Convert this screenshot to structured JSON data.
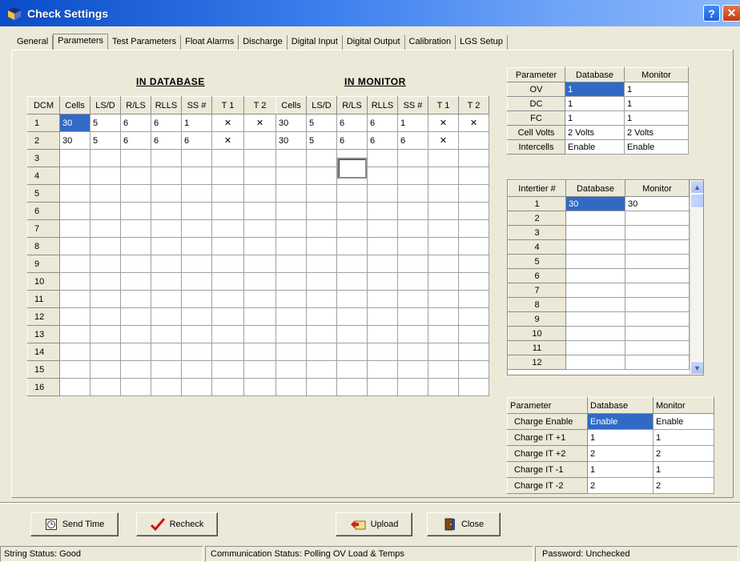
{
  "window": {
    "title": "Check Settings",
    "help_label": "?",
    "close_label": "✕"
  },
  "tabs": [
    "General",
    "Parameters",
    "Test Parameters",
    "Float Alarms",
    "Discharge",
    "Digital Input",
    "Digital Output",
    "Calibration",
    "LGS Setup"
  ],
  "active_tab": 1,
  "in_database": {
    "title": "IN DATABASE",
    "columns": [
      "DCM",
      "Cells",
      "LS/D",
      "R/LS",
      "RLLS",
      "SS #",
      "T 1",
      "T 2"
    ],
    "rows": [
      [
        "1",
        "30",
        "5",
        "6",
        "6",
        "1",
        "✕",
        "✕"
      ],
      [
        "2",
        "30",
        "5",
        "6",
        "6",
        "6",
        "✕",
        ""
      ],
      [
        "3",
        "",
        "",
        "",
        "",
        "",
        "",
        ""
      ],
      [
        "4",
        "",
        "",
        "",
        "",
        "",
        "",
        ""
      ],
      [
        "5",
        "",
        "",
        "",
        "",
        "",
        "",
        ""
      ],
      [
        "6",
        "",
        "",
        "",
        "",
        "",
        "",
        ""
      ],
      [
        "7",
        "",
        "",
        "",
        "",
        "",
        "",
        ""
      ],
      [
        "8",
        "",
        "",
        "",
        "",
        "",
        "",
        ""
      ],
      [
        "9",
        "",
        "",
        "",
        "",
        "",
        "",
        ""
      ],
      [
        "10",
        "",
        "",
        "",
        "",
        "",
        "",
        ""
      ],
      [
        "11",
        "",
        "",
        "",
        "",
        "",
        "",
        ""
      ],
      [
        "12",
        "",
        "",
        "",
        "",
        "",
        "",
        ""
      ],
      [
        "13",
        "",
        "",
        "",
        "",
        "",
        "",
        ""
      ],
      [
        "14",
        "",
        "",
        "",
        "",
        "",
        "",
        ""
      ],
      [
        "15",
        "",
        "",
        "",
        "",
        "",
        "",
        ""
      ],
      [
        "16",
        "",
        "",
        "",
        "",
        "",
        "",
        ""
      ]
    ]
  },
  "in_monitor": {
    "title": "IN MONITOR",
    "columns": [
      "Cells",
      "LS/D",
      "R/LS",
      "RLLS",
      "SS #",
      "T 1",
      "T 2"
    ],
    "rows": [
      [
        "30",
        "5",
        "6",
        "6",
        "1",
        "✕",
        "✕"
      ],
      [
        "30",
        "5",
        "6",
        "6",
        "6",
        "✕",
        ""
      ],
      [
        "",
        "",
        "",
        "",
        "",
        "",
        ""
      ],
      [
        "",
        "",
        "",
        "",
        "",
        "",
        ""
      ],
      [
        "",
        "",
        "",
        "",
        "",
        "",
        ""
      ],
      [
        "",
        "",
        "",
        "",
        "",
        "",
        ""
      ],
      [
        "",
        "",
        "",
        "",
        "",
        "",
        ""
      ],
      [
        "",
        "",
        "",
        "",
        "",
        "",
        ""
      ],
      [
        "",
        "",
        "",
        "",
        "",
        "",
        ""
      ],
      [
        "",
        "",
        "",
        "",
        "",
        "",
        ""
      ],
      [
        "",
        "",
        "",
        "",
        "",
        "",
        ""
      ],
      [
        "",
        "",
        "",
        "",
        "",
        "",
        ""
      ],
      [
        "",
        "",
        "",
        "",
        "",
        "",
        ""
      ],
      [
        "",
        "",
        "",
        "",
        "",
        "",
        ""
      ],
      [
        "",
        "",
        "",
        "",
        "",
        "",
        ""
      ],
      [
        "",
        "",
        "",
        "",
        "",
        "",
        ""
      ]
    ]
  },
  "param_table": {
    "columns": [
      "Parameter",
      "Database",
      "Monitor"
    ],
    "rows": [
      [
        "OV",
        "1",
        "1"
      ],
      [
        "DC",
        "1",
        "1"
      ],
      [
        "FC",
        "1",
        "1"
      ],
      [
        "Cell Volts",
        "2 Volts",
        "2 Volts"
      ],
      [
        "Intercells",
        "Enable",
        "Enable"
      ]
    ]
  },
  "intertier_table": {
    "columns": [
      "Intertier #",
      "Database",
      "Monitor"
    ],
    "rows": [
      [
        "1",
        "30",
        "30"
      ],
      [
        "2",
        "",
        ""
      ],
      [
        "3",
        "",
        ""
      ],
      [
        "4",
        "",
        ""
      ],
      [
        "5",
        "",
        ""
      ],
      [
        "6",
        "",
        ""
      ],
      [
        "7",
        "",
        ""
      ],
      [
        "8",
        "",
        ""
      ],
      [
        "9",
        "",
        ""
      ],
      [
        "10",
        "",
        ""
      ],
      [
        "11",
        "",
        ""
      ],
      [
        "12",
        "",
        ""
      ]
    ]
  },
  "charge_table": {
    "columns": [
      "Parameter",
      "Database",
      "Monitor"
    ],
    "rows": [
      [
        "Charge Enable",
        "Enable",
        "Enable"
      ],
      [
        "Charge IT +1",
        "1",
        "1"
      ],
      [
        "Charge IT +2",
        "2",
        "2"
      ],
      [
        "Charge IT -1",
        "1",
        "1"
      ],
      [
        "Charge IT -2",
        "2",
        "2"
      ]
    ]
  },
  "buttons": {
    "send_time": "Send Time",
    "recheck": "Recheck",
    "upload": "Upload",
    "close": "Close"
  },
  "status": {
    "string_status": "String Status:  Good",
    "communication_status": "Communication Status:  Polling OV Load & Temps",
    "password": "Password:  Unchecked"
  },
  "colors": {
    "title_bar": "#0a4cc9",
    "selection": "#316ac5",
    "face": "#ece9d8"
  }
}
